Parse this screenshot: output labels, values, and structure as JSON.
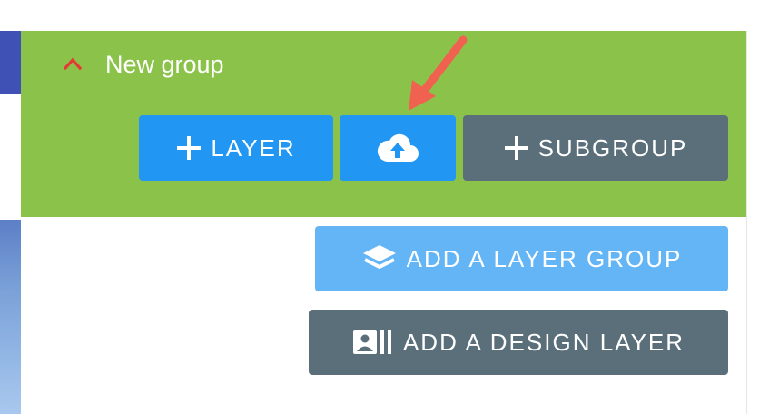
{
  "group": {
    "title": "New group",
    "color": "#8bc34a",
    "chevron_color": "#e53935"
  },
  "buttons": {
    "layer": {
      "label": "LAYER",
      "icon": "plus-icon"
    },
    "upload": {
      "icon": "cloud-upload-icon"
    },
    "subgroup": {
      "label": "SUBGROUP",
      "icon": "plus-icon"
    },
    "add_layer_group": {
      "label": "ADD A LAYER GROUP",
      "icon": "layers-icon"
    },
    "add_design_layer": {
      "label": "ADD A DESIGN LAYER",
      "icon": "design-layer-icon"
    }
  },
  "colors": {
    "primary": "#2196f3",
    "primary_light": "#64b5f6",
    "slate": "#5a6f7a",
    "annotation_arrow": "#f0614f"
  }
}
